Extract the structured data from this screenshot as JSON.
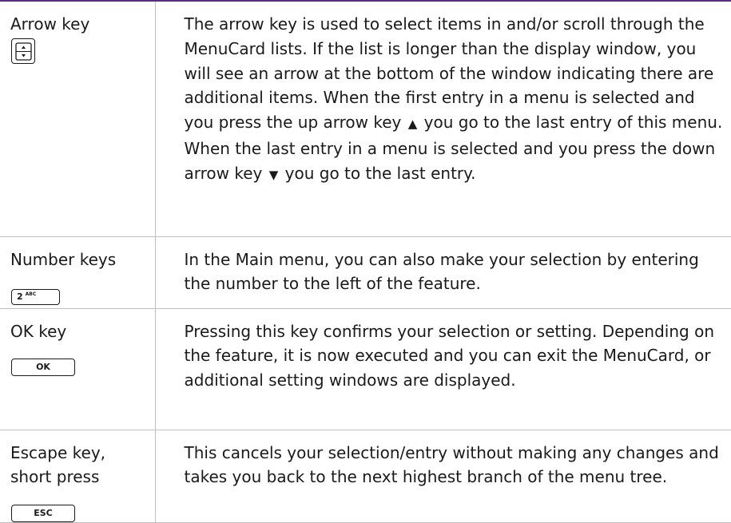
{
  "rows": [
    {
      "key_label": "Arrow key",
      "key_icon": "arrow-up-down-key-icon",
      "desc_part1": "The arrow key is used to select items in and/or scroll through the MenuCard lists. If the list is longer than the display window, you will see an arrow at the bottom of the window indicating there are additional items. When the first entry in a menu is selected and you press the up arrow key",
      "up_symbol": "▲",
      "desc_part2": "you go to the last entry of this menu. When the last entry in a menu is selected and you press the down arrow key",
      "down_symbol": "▼",
      "desc_part3": "you go to the last entry."
    },
    {
      "key_label": "Number keys",
      "key_icon_number": "2",
      "key_icon_letters": "ABC",
      "desc": "In the Main menu, you can also make your selection by entering the number to the left of the feature."
    },
    {
      "key_label": "OK key",
      "key_icon_text": "OK",
      "desc": "Pressing this key confirms your selection or setting. Depending on the feature, it is now executed and you can exit the MenuCard, or additional setting windows are displayed."
    },
    {
      "key_label": "Escape key,\nshort press",
      "key_icon_text": "ESC",
      "desc": "This cancels your selection/entry without making any changes and takes you back to the next highest branch of the menu tree."
    }
  ],
  "colors": {
    "accent_rule": "#5b2d82",
    "grid_lines": "#bfbfbf",
    "text": "#1a1a1a"
  }
}
